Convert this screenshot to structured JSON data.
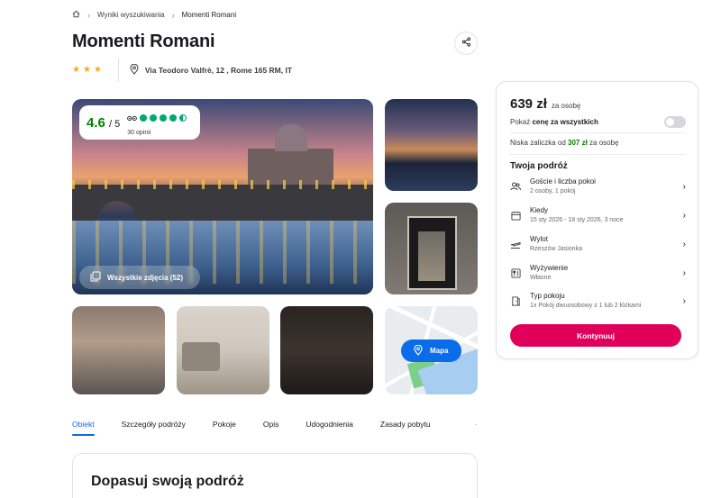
{
  "breadcrumb": {
    "home_icon": "home-icon",
    "search_results": "Wyniki wyszukiwania",
    "current": "Momenti Romani"
  },
  "hotel": {
    "name": "Momenti Romani",
    "stars": 3,
    "address": "Via Teodoro Valfrè, 12 , Rome 165 RM, IT"
  },
  "rating": {
    "score": "4.6",
    "out_of": "/ 5",
    "reviews": "30 opinii",
    "tripadvisor_bubbles": 4.5
  },
  "gallery": {
    "all_photos": "Wszystkie zdjęcia (52)",
    "map_label": "Mapa"
  },
  "tabs": [
    {
      "label": "Obiekt",
      "active": true
    },
    {
      "label": "Szczegóły podróży",
      "active": false
    },
    {
      "label": "Pokoje",
      "active": false
    },
    {
      "label": "Opis",
      "active": false
    },
    {
      "label": "Udogodnienia",
      "active": false
    },
    {
      "label": "Zasady pobytu",
      "active": false
    }
  ],
  "section": {
    "title": "Dopasuj swoją podróż"
  },
  "booking": {
    "price": "639 zł",
    "price_unit": "za osobę",
    "toggle_prefix": "Pokaż ",
    "toggle_bold": "cenę za wszystkich",
    "toggle_on": false,
    "deposit_prefix": "Niska zaliczka od ",
    "deposit_amount": "307 zł",
    "deposit_suffix": " za osobę",
    "trip_title": "Twoja podróż",
    "rows": [
      {
        "icon": "guests-icon",
        "label": "Goście i liczba pokoi",
        "value": "2 osoby, 1 pokój"
      },
      {
        "icon": "calendar-icon",
        "label": "Kiedy",
        "value": "15 sty 2026 - 18 sty 2026, 3 noce"
      },
      {
        "icon": "plane-icon",
        "label": "Wylot",
        "value": "Rzeszów Jasionka"
      },
      {
        "icon": "meal-icon",
        "label": "Wyżywienie",
        "value": "Własne"
      },
      {
        "icon": "room-icon",
        "label": "Typ pokoju",
        "value": "1x Pokój dwuosobowy z 1 lub 2 łóżkami"
      }
    ],
    "continue": "Kontynuuj"
  },
  "colors": {
    "accent_blue": "#0a6ce8",
    "cta_pink": "#e0005a",
    "rating_green": "#008000",
    "star": "#f5a623"
  }
}
